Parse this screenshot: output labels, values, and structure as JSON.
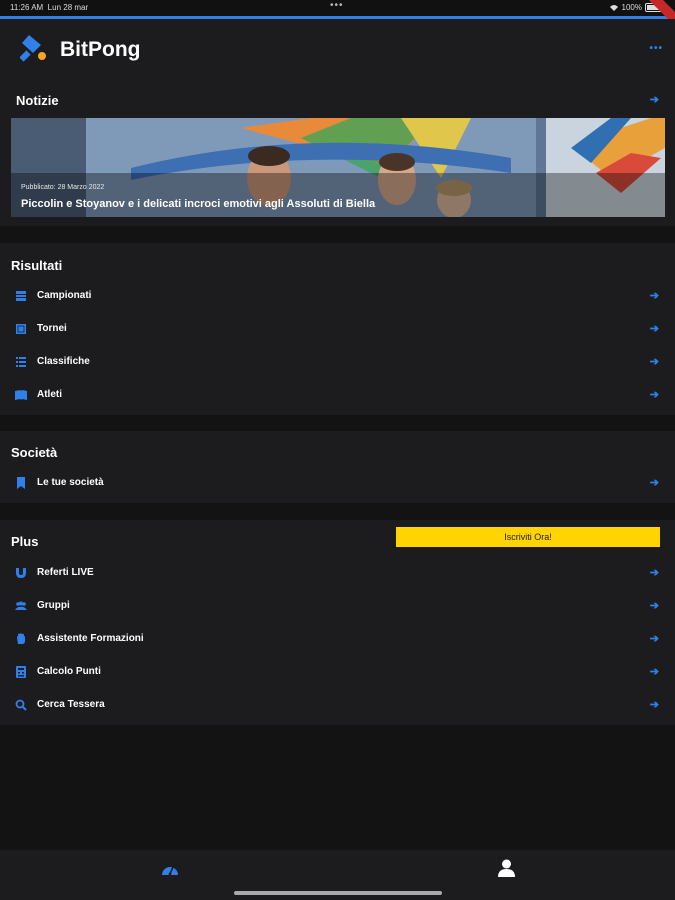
{
  "status_bar": {
    "time": "11:26 AM",
    "date": "Lun 28 mar",
    "battery": "100%"
  },
  "app": {
    "title": "BitPong"
  },
  "news": {
    "title": "Notizie",
    "item": {
      "date": "Pubblicato: 28 Marzo 2022",
      "headline": "Piccolin e Stoyanov e i delicati incroci emotivi agli Assoluti di Biella"
    }
  },
  "results": {
    "title": "Risultati",
    "items": [
      {
        "label": "Campionati",
        "icon": "calendar-icon"
      },
      {
        "label": "Tornei",
        "icon": "grid-icon"
      },
      {
        "label": "Classifiche",
        "icon": "list-icon"
      },
      {
        "label": "Atleti",
        "icon": "book-icon"
      }
    ]
  },
  "society": {
    "title": "Società",
    "items": [
      {
        "label": "Le tue società",
        "icon": "bookmark-icon"
      }
    ]
  },
  "plus": {
    "title": "Plus",
    "cta": "Iscriviti Ora!",
    "items": [
      {
        "label": "Referti LIVE",
        "icon": "magnet-icon"
      },
      {
        "label": "Gruppi",
        "icon": "group-icon"
      },
      {
        "label": "Assistente Formazioni",
        "icon": "hand-icon"
      },
      {
        "label": "Calcolo Punti",
        "icon": "calculator-icon"
      },
      {
        "label": "Cerca Tessera",
        "icon": "search-icon"
      }
    ]
  },
  "colors": {
    "accent": "#2f80e8",
    "cta": "#ffd400",
    "background": "#131313",
    "surface": "#1c1c1f"
  }
}
